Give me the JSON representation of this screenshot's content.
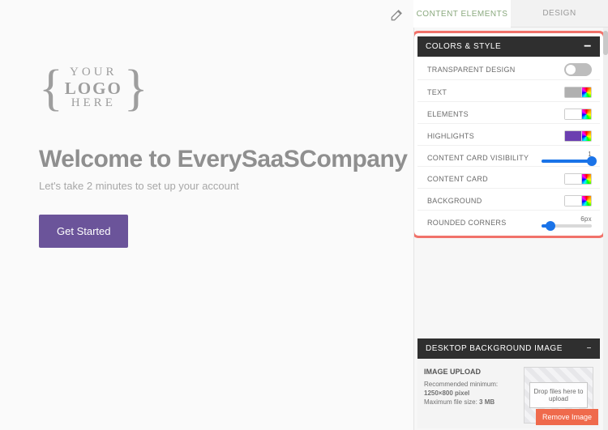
{
  "logo": {
    "line1": "YOUR",
    "line2": "LOGO",
    "line3": "HERE"
  },
  "headline": "Welcome to EverySaaSCompany",
  "subhead": "Let's take 2 minutes to set up your account",
  "cta_label": "Get Started",
  "tabs": {
    "content": "CONTENT ELEMENTS",
    "design": "DESIGN"
  },
  "sections": {
    "colors_style": {
      "title": "COLORS & STYLE",
      "rows": {
        "transparent": "TRANSPARENT DESIGN",
        "text": "TEXT",
        "elements": "ELEMENTS",
        "highlights": "HIGHLIGHTS",
        "card_visibility": "CONTENT CARD VISIBILITY",
        "content_card": "CONTENT CARD",
        "background": "BACKGROUND",
        "rounded": "ROUNDED CORNERS"
      },
      "values": {
        "card_visibility": "1",
        "rounded": "6px"
      },
      "colors": {
        "text": "#b0b0b0",
        "elements": "#ffffff",
        "highlights": "#6b3fb0",
        "content_card": "#ffffff",
        "background": "#ffffff"
      }
    },
    "bg_image": {
      "title": "DESKTOP BACKGROUND IMAGE",
      "upload_title": "IMAGE UPLOAD",
      "rec_line1": "Recommended minimum:",
      "rec_line2_a": "1250×800 pixel",
      "rec_line3_a": "Maximum file size: ",
      "rec_line3_b": "3 MB",
      "drop_text": "Drop files here to upload",
      "remove_label": "Remove Image"
    }
  },
  "collapse_glyph": "−"
}
